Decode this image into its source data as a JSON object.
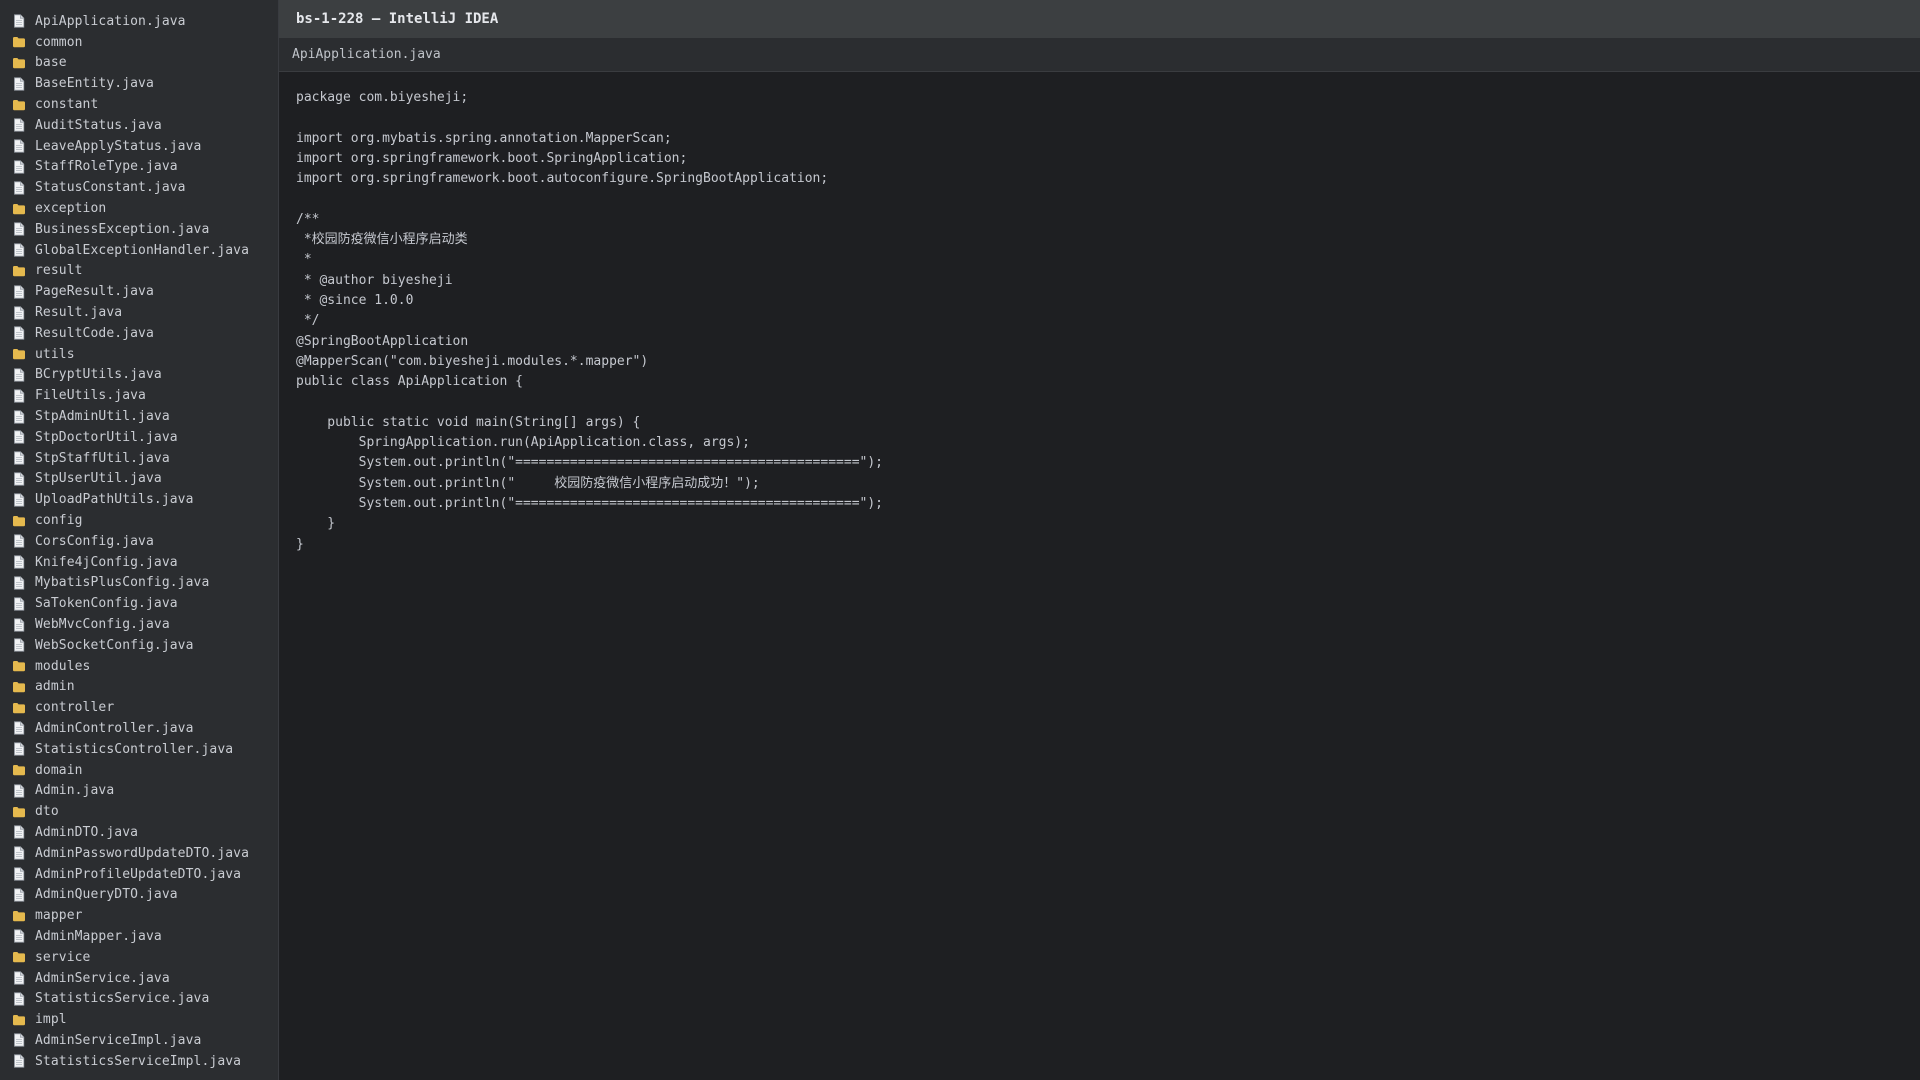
{
  "window": {
    "title": "bs-1-228 — IntelliJ IDEA"
  },
  "tab": {
    "label": "ApiApplication.java"
  },
  "colors": {
    "folder": "#e5b94e",
    "file": "#c9ccd2",
    "sidebar_bg": "#2b2d30",
    "editor_bg": "#1e1f22",
    "titlebar_bg": "#3c3f41"
  },
  "tree": [
    {
      "label": "ApiApplication.java",
      "type": "file"
    },
    {
      "label": "common",
      "type": "folder"
    },
    {
      "label": "base",
      "type": "folder"
    },
    {
      "label": "BaseEntity.java",
      "type": "file"
    },
    {
      "label": "constant",
      "type": "folder"
    },
    {
      "label": "AuditStatus.java",
      "type": "file"
    },
    {
      "label": "LeaveApplyStatus.java",
      "type": "file"
    },
    {
      "label": "StaffRoleType.java",
      "type": "file"
    },
    {
      "label": "StatusConstant.java",
      "type": "file"
    },
    {
      "label": "exception",
      "type": "folder"
    },
    {
      "label": "BusinessException.java",
      "type": "file"
    },
    {
      "label": "GlobalExceptionHandler.java",
      "type": "file"
    },
    {
      "label": "result",
      "type": "folder"
    },
    {
      "label": "PageResult.java",
      "type": "file"
    },
    {
      "label": "Result.java",
      "type": "file"
    },
    {
      "label": "ResultCode.java",
      "type": "file"
    },
    {
      "label": "utils",
      "type": "folder"
    },
    {
      "label": "BCryptUtils.java",
      "type": "file"
    },
    {
      "label": "FileUtils.java",
      "type": "file"
    },
    {
      "label": "StpAdminUtil.java",
      "type": "file"
    },
    {
      "label": "StpDoctorUtil.java",
      "type": "file"
    },
    {
      "label": "StpStaffUtil.java",
      "type": "file"
    },
    {
      "label": "StpUserUtil.java",
      "type": "file"
    },
    {
      "label": "UploadPathUtils.java",
      "type": "file"
    },
    {
      "label": "config",
      "type": "folder"
    },
    {
      "label": "CorsConfig.java",
      "type": "file"
    },
    {
      "label": "Knife4jConfig.java",
      "type": "file"
    },
    {
      "label": "MybatisPlusConfig.java",
      "type": "file"
    },
    {
      "label": "SaTokenConfig.java",
      "type": "file"
    },
    {
      "label": "WebMvcConfig.java",
      "type": "file"
    },
    {
      "label": "WebSocketConfig.java",
      "type": "file"
    },
    {
      "label": "modules",
      "type": "folder"
    },
    {
      "label": "admin",
      "type": "folder"
    },
    {
      "label": "controller",
      "type": "folder"
    },
    {
      "label": "AdminController.java",
      "type": "file"
    },
    {
      "label": "StatisticsController.java",
      "type": "file"
    },
    {
      "label": "domain",
      "type": "folder"
    },
    {
      "label": "Admin.java",
      "type": "file"
    },
    {
      "label": "dto",
      "type": "folder"
    },
    {
      "label": "AdminDTO.java",
      "type": "file"
    },
    {
      "label": "AdminPasswordUpdateDTO.java",
      "type": "file"
    },
    {
      "label": "AdminProfileUpdateDTO.java",
      "type": "file"
    },
    {
      "label": "AdminQueryDTO.java",
      "type": "file"
    },
    {
      "label": "mapper",
      "type": "folder"
    },
    {
      "label": "AdminMapper.java",
      "type": "file"
    },
    {
      "label": "service",
      "type": "folder"
    },
    {
      "label": "AdminService.java",
      "type": "file"
    },
    {
      "label": "StatisticsService.java",
      "type": "file"
    },
    {
      "label": "impl",
      "type": "folder"
    },
    {
      "label": "AdminServiceImpl.java",
      "type": "file"
    },
    {
      "label": "StatisticsServiceImpl.java",
      "type": "file"
    }
  ],
  "code": [
    "package com.biyesheji;",
    "",
    "import org.mybatis.spring.annotation.MapperScan;",
    "import org.springframework.boot.SpringApplication;",
    "import org.springframework.boot.autoconfigure.SpringBootApplication;",
    "",
    "/**",
    " *校园防疫微信小程序启动类",
    " *",
    " * @author biyesheji",
    " * @since 1.0.0",
    " */",
    "@SpringBootApplication",
    "@MapperScan(\"com.biyesheji.modules.*.mapper\")",
    "public class ApiApplication {",
    "",
    "    public static void main(String[] args) {",
    "        SpringApplication.run(ApiApplication.class, args);",
    "        System.out.println(\"============================================\");",
    "        System.out.println(\"     校园防疫微信小程序启动成功！\");",
    "        System.out.println(\"============================================\");",
    "    }",
    "}"
  ]
}
